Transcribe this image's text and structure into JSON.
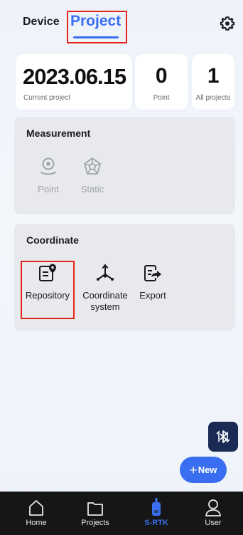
{
  "header": {
    "tab_device": "Device",
    "tab_project": "Project",
    "settings_icon": "gear-icon"
  },
  "stats": {
    "current_project_value": "2023.06.15",
    "current_project_label": "Current project",
    "point_value": "0",
    "point_label": "Point",
    "all_projects_value": "1",
    "all_projects_label": "All projects"
  },
  "measurement": {
    "title": "Measurement",
    "items": [
      {
        "label": "Point",
        "icon": "location-pin-icon",
        "enabled": false
      },
      {
        "label": "Static",
        "icon": "satellite-icon",
        "enabled": false
      }
    ]
  },
  "coordinate": {
    "title": "Coordinate",
    "items": [
      {
        "label": "Repository",
        "icon": "document-pin-icon"
      },
      {
        "label_line1": "Coordinate",
        "label_line2": "system",
        "icon": "axes-icon"
      },
      {
        "label": "Export",
        "icon": "export-icon"
      }
    ]
  },
  "fab": {
    "new_label": "New",
    "bluetooth_icon": "bluetooth-toggle-icon"
  },
  "bottom_nav": {
    "items": [
      {
        "label": "Home",
        "icon": "home-icon"
      },
      {
        "label": "Projects",
        "icon": "folder-icon"
      },
      {
        "label": "S-RTK",
        "icon": "receiver-icon",
        "active": true
      },
      {
        "label": "User",
        "icon": "user-icon"
      }
    ]
  },
  "colors": {
    "accent": "#3a6ef0",
    "annotation": "#e5241a",
    "nav_background": "#161616",
    "section_background": "#e8e9ed"
  }
}
